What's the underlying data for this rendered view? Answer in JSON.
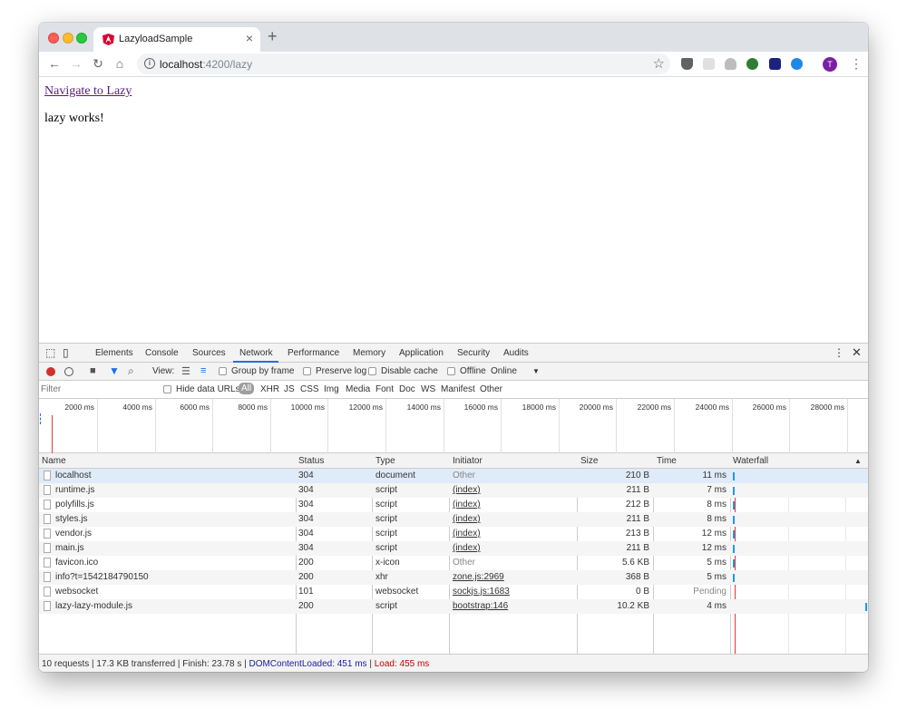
{
  "browser": {
    "tab_title": "LazyloadSample",
    "close": "×",
    "new_tab": "+",
    "url_host": "localhost",
    "url_path": ":4200/lazy",
    "avatar_initial": "T"
  },
  "page": {
    "link_text": "Navigate to Lazy",
    "body_text": "lazy works!"
  },
  "devtools": {
    "tabs": [
      "Elements",
      "Console",
      "Sources",
      "Network",
      "Performance",
      "Memory",
      "Application",
      "Security",
      "Audits"
    ],
    "active_tab": "Network",
    "toolbar": {
      "view_label": "View:",
      "group_by_frame": "Group by frame",
      "preserve_log": "Preserve log",
      "disable_cache": "Disable cache",
      "offline": "Offline",
      "throttle": "Online"
    },
    "filter": {
      "placeholder": "Filter",
      "hide_data_urls": "Hide data URLs",
      "types": [
        "All",
        "XHR",
        "JS",
        "CSS",
        "Img",
        "Media",
        "Font",
        "Doc",
        "WS",
        "Manifest",
        "Other"
      ]
    },
    "overview_ticks": [
      "2000 ms",
      "4000 ms",
      "6000 ms",
      "8000 ms",
      "10000 ms",
      "12000 ms",
      "14000 ms",
      "16000 ms",
      "18000 ms",
      "20000 ms",
      "22000 ms",
      "24000 ms",
      "26000 ms",
      "28000 ms"
    ],
    "columns": [
      "Name",
      "Status",
      "Type",
      "Initiator",
      "Size",
      "Time",
      "Waterfall"
    ],
    "rows": [
      {
        "name": "localhost",
        "status": "304",
        "type": "document",
        "initiator": "Other",
        "size": "210 B",
        "time": "11 ms"
      },
      {
        "name": "runtime.js",
        "status": "304",
        "type": "script",
        "initiator": "(index)",
        "size": "211 B",
        "time": "7 ms"
      },
      {
        "name": "polyfills.js",
        "status": "304",
        "type": "script",
        "initiator": "(index)",
        "size": "212 B",
        "time": "8 ms"
      },
      {
        "name": "styles.js",
        "status": "304",
        "type": "script",
        "initiator": "(index)",
        "size": "211 B",
        "time": "8 ms"
      },
      {
        "name": "vendor.js",
        "status": "304",
        "type": "script",
        "initiator": "(index)",
        "size": "213 B",
        "time": "12 ms"
      },
      {
        "name": "main.js",
        "status": "304",
        "type": "script",
        "initiator": "(index)",
        "size": "211 B",
        "time": "12 ms"
      },
      {
        "name": "favicon.ico",
        "status": "200",
        "type": "x-icon",
        "initiator": "Other",
        "size": "5.6 KB",
        "time": "5 ms"
      },
      {
        "name": "info?t=1542184790150",
        "status": "200",
        "type": "xhr",
        "initiator": "zone.js:2969",
        "size": "368 B",
        "time": "5 ms"
      },
      {
        "name": "websocket",
        "status": "101",
        "type": "websocket",
        "initiator": "sockjs.js:1683",
        "size": "0 B",
        "time": "Pending"
      },
      {
        "name": "lazy-lazy-module.js",
        "status": "200",
        "type": "script",
        "initiator": "bootstrap:146",
        "size": "10.2 KB",
        "time": "4 ms"
      }
    ],
    "summary": {
      "main": "10 requests | 17.3 KB transferred | Finish: 23.78 s | ",
      "dcl": "DOMContentLoaded: 451 ms",
      "sep": " | ",
      "load": "Load: 455 ms"
    }
  }
}
